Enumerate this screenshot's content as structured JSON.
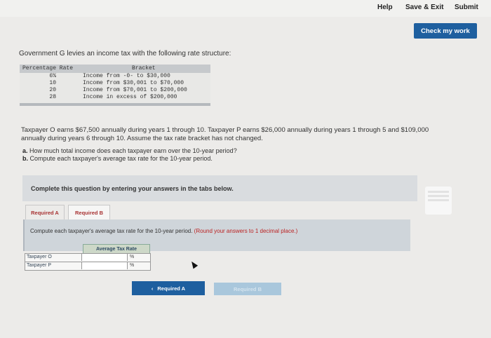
{
  "header": {
    "help_label": "Help",
    "save_exit_label": "Save & Exit",
    "submit_label": "Submit",
    "check_work_label": "Check my work"
  },
  "question": {
    "intro": "Government G levies an income tax with the following rate structure:",
    "rate_table": {
      "col1_header": "Percentage Rate",
      "col2_header": "Bracket",
      "rows": [
        {
          "rate": "6%",
          "bracket": "Income from -0- to $30,000"
        },
        {
          "rate": "10",
          "bracket": "Income from $30,001 to $70,000"
        },
        {
          "rate": "20",
          "bracket": "Income from $70,001 to $200,000"
        },
        {
          "rate": "28",
          "bracket": "Income in excess of $200,000"
        }
      ]
    },
    "scenario": "Taxpayer O earns $67,500 annually during years 1 through 10. Taxpayer P earns $26,000 annually during years 1 through 5 and $109,000 annually during years 6 through 10. Assume the tax rate bracket has not changed.",
    "part_a": "How much total income does each taxpayer earn over the 10-year period?",
    "part_b": "Compute each taxpayer's average tax rate for the 10-year period.",
    "part_a_marker": "a.",
    "part_b_marker": "b."
  },
  "complete_instruction": "Complete this question by entering your answers in the tabs below.",
  "tabs": [
    {
      "label": "Required A"
    },
    {
      "label": "Required B"
    }
  ],
  "panel": {
    "instruction": "Compute each taxpayer's average tax rate for the 10-year period.",
    "round_note": "(Round your answers to 1 decimal place.)"
  },
  "answer_table": {
    "header": "Average Tax Rate",
    "rows": [
      {
        "label": "Taxpayer O",
        "value": "",
        "unit": "%"
      },
      {
        "label": "Taxpayer P",
        "value": "",
        "unit": "%"
      }
    ]
  },
  "nav": {
    "prev_label": "Required A",
    "prev_icon": "chevron-left-icon",
    "next_label": "Required B"
  }
}
